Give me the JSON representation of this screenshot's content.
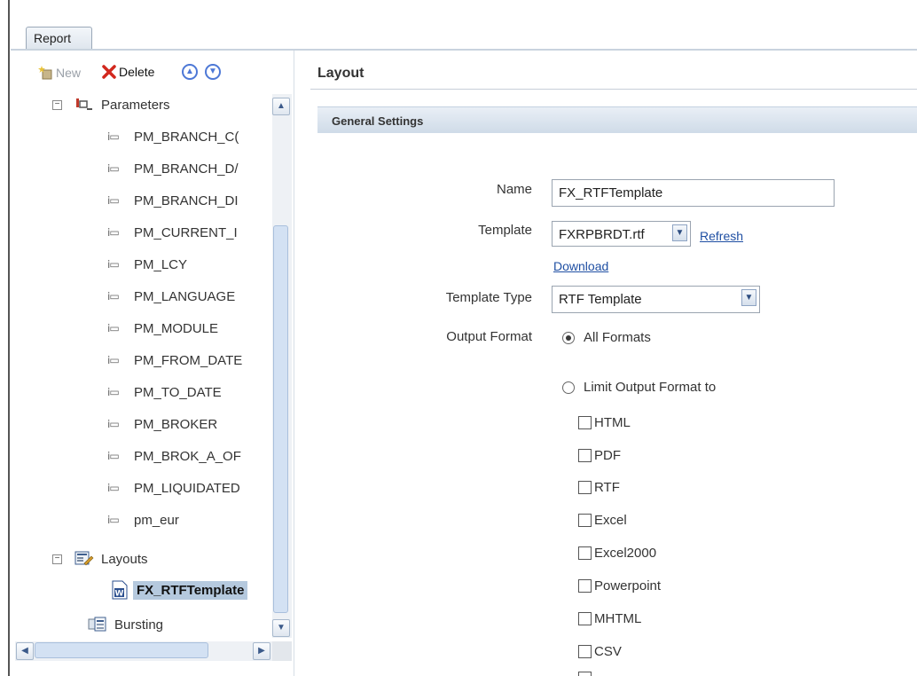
{
  "tab": {
    "label": "Report"
  },
  "toolbar": {
    "new_label": "New",
    "delete_label": "Delete"
  },
  "tree": {
    "parameters_label": "Parameters",
    "params": [
      "PM_BRANCH_C(",
      "PM_BRANCH_D/",
      "PM_BRANCH_DI",
      "PM_CURRENT_I",
      "PM_LCY",
      "PM_LANGUAGE",
      "PM_MODULE",
      "PM_FROM_DATE",
      "PM_TO_DATE",
      "PM_BROKER",
      "PM_BROK_A_OF",
      "PM_LIQUIDATED",
      "pm_eur"
    ],
    "layouts_label": "Layouts",
    "layout_item": "FX_RTFTemplate",
    "bursting_label": "Bursting"
  },
  "layout": {
    "title": "Layout",
    "section": "General Settings",
    "name_label": "Name",
    "name_value": "FX_RTFTemplate",
    "template_label": "Template",
    "template_value": "FXRPBRDT.rtf",
    "refresh_label": "Refresh",
    "download_label": "Download",
    "template_type_label": "Template Type",
    "template_type_value": "RTF Template",
    "output_format_label": "Output Format",
    "all_formats_label": "All Formats",
    "limit_label": "Limit Output Format to",
    "formats": [
      "HTML",
      "PDF",
      "RTF",
      "Excel",
      "Excel2000",
      "Powerpoint",
      "MHTML",
      "CSV"
    ]
  }
}
